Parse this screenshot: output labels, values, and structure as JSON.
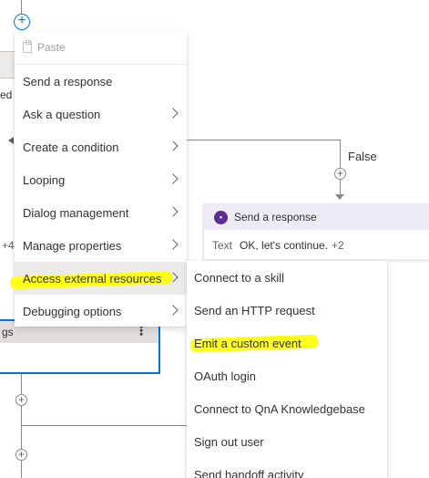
{
  "canvas": {
    "false_label": "False",
    "bg_left_text": "ed",
    "bg_left_plus": "+4",
    "blue_node_title": "gs",
    "blue_node_more": "⋮",
    "response_node": {
      "title": "Send a response",
      "text_label": "Text",
      "text_value": "OK, let's continue.",
      "more": "+2",
      "icon_color": "#5c2e91"
    },
    "accent_color": "#0078d4"
  },
  "main_menu": {
    "paste": "Paste",
    "items": [
      "Send a response",
      "Ask a question",
      "Create a condition",
      "Looping",
      "Dialog management",
      "Manage properties",
      "Access external resources",
      "Debugging options"
    ],
    "selected": "Access external resources"
  },
  "sub_menu": {
    "items": [
      "Connect to a skill",
      "Send an HTTP request",
      "Emit a custom event",
      "OAuth login",
      "Connect to QnA Knowledgebase",
      "Sign out user",
      "Send handoff activity"
    ],
    "highlighted": "Emit a custom event",
    "highlight_color": "#ffff1a"
  }
}
